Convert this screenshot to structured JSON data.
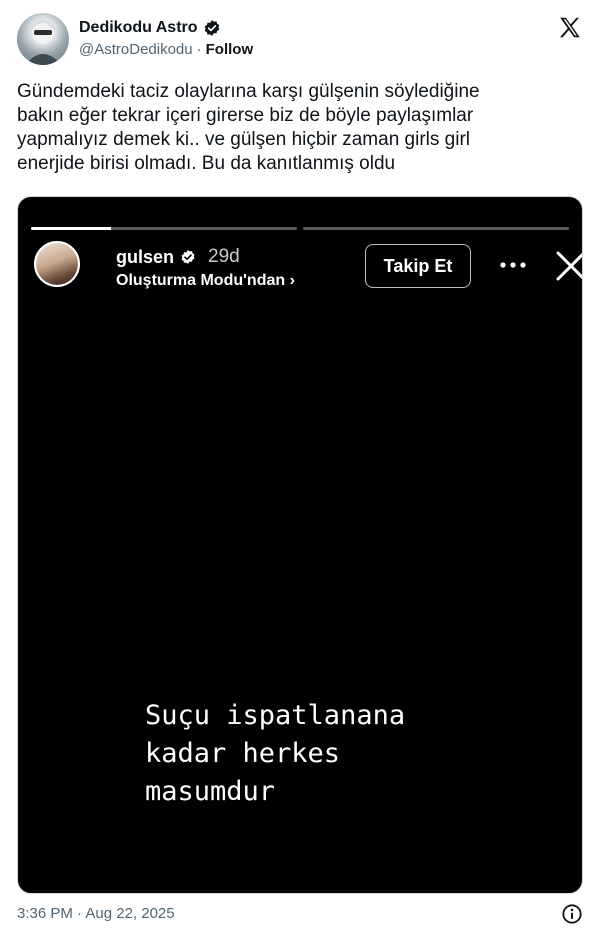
{
  "author": {
    "name": "Dedikodu Astro",
    "handle": "@AstroDedikodu",
    "separator": "·",
    "follow_label": "Follow"
  },
  "tweet": {
    "text": "Gündemdeki taciz olaylarına karşı gülşenin söylediğine\nbakın eğer tekrar içeri girerse biz de böyle paylaşımlar\nyapmalıyız demek ki.. ve gülşen hiçbir zaman girls girl\nenerjide birisi olmadı. Bu da kanıtlanmış oldu"
  },
  "story": {
    "username": "gulsen",
    "time_ago": "29d",
    "subtitle": "Oluşturma Modu'ndan ›",
    "follow_button": "Takip Et",
    "overlay_text": "Suçu ispatlanana\nkadar herkes\nmasumdur",
    "progress": [
      0.3,
      0.0
    ]
  },
  "footer": {
    "timestamp": "3:36 PM · Aug 22, 2025"
  },
  "icons": {
    "verified": "verified-badge-icon",
    "x_logo": "x-logo-icon",
    "more": "more-dots-icon",
    "close": "close-icon",
    "info": "info-icon"
  },
  "colors": {
    "text_primary": "#0f1419",
    "text_secondary": "#536471",
    "story_bg": "#000000",
    "verified_fill": "#0f1419"
  }
}
